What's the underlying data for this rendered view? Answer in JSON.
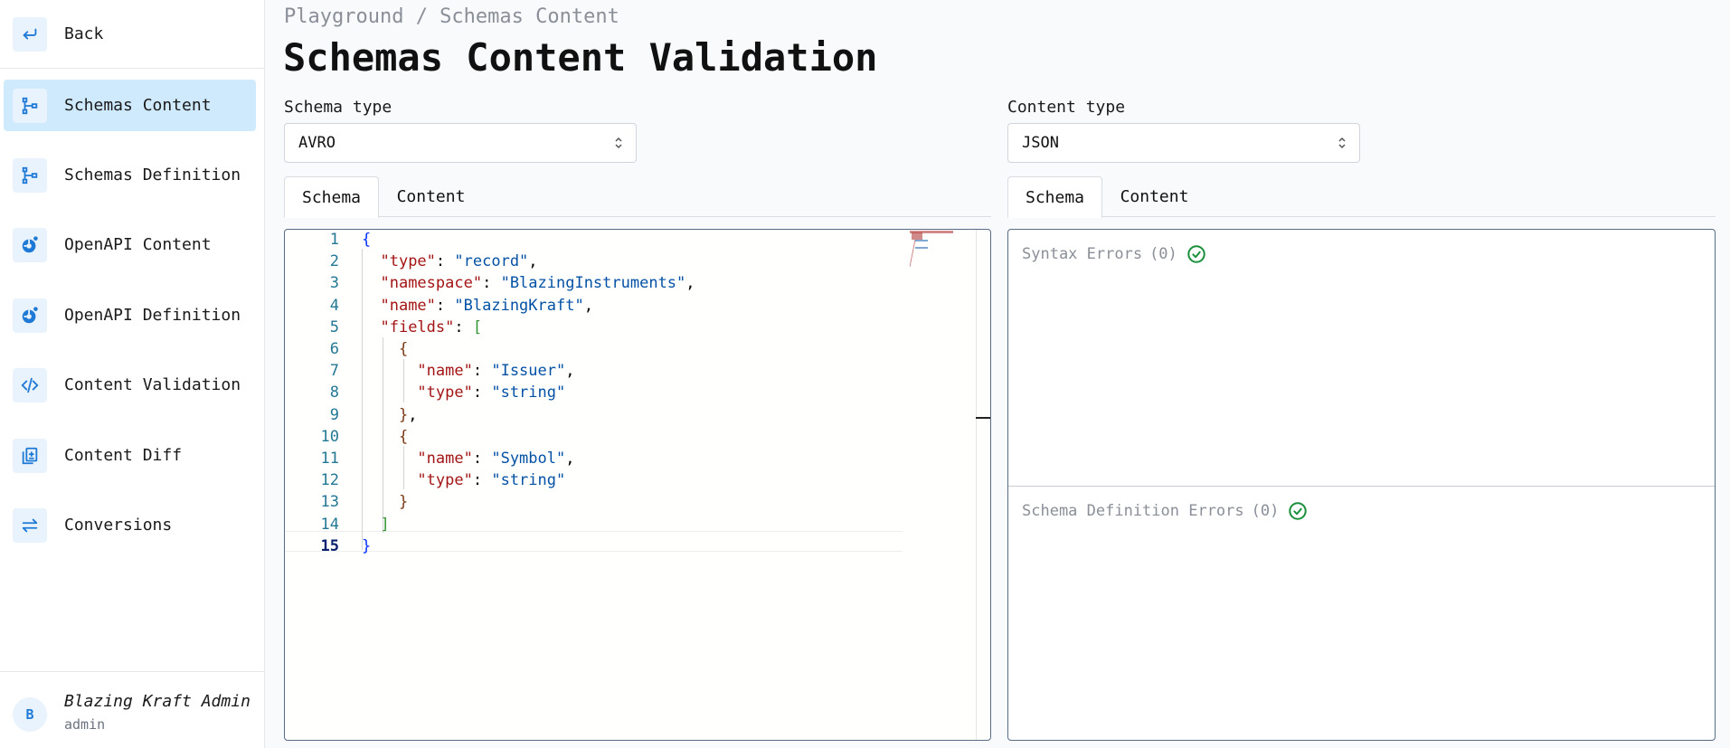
{
  "sidebar": {
    "back_label": "Back",
    "items": [
      {
        "label": "Schemas Content",
        "icon": "schema-tree-icon",
        "active": true
      },
      {
        "label": "Schemas Definition",
        "icon": "schema-tree-icon",
        "active": false
      },
      {
        "label": "OpenAPI Content",
        "icon": "openapi-icon",
        "active": false
      },
      {
        "label": "OpenAPI Definition",
        "icon": "openapi-icon",
        "active": false
      },
      {
        "label": "Content Validation",
        "icon": "code-icon",
        "active": false
      },
      {
        "label": "Content Diff",
        "icon": "diff-icon",
        "active": false
      },
      {
        "label": "Conversions",
        "icon": "arrows-exchange-icon",
        "active": false
      }
    ],
    "user": {
      "avatar": "B",
      "name": "Blazing Kraft Admin",
      "role": "admin"
    }
  },
  "header": {
    "breadcrumb": "Playground / Schemas Content",
    "title": "Schemas Content Validation"
  },
  "left": {
    "select_label": "Schema type",
    "select_value": "AVRO",
    "tabs": [
      "Schema",
      "Content"
    ],
    "active_tab": "Schema"
  },
  "right": {
    "select_label": "Content type",
    "select_value": "JSON",
    "tabs": [
      "Schema",
      "Content"
    ],
    "active_tab": "Schema"
  },
  "editor": {
    "current_line": 15,
    "lines": [
      "{",
      "  \"type\": \"record\",",
      "  \"namespace\": \"BlazingInstruments\",",
      "  \"name\": \"BlazingKraft\",",
      "  \"fields\": [",
      "    {",
      "      \"name\": \"Issuer\",",
      "      \"type\": \"string\"",
      "    },",
      "    {",
      "      \"name\": \"Symbol\",",
      "      \"type\": \"string\"",
      "    }",
      "  ]",
      "}"
    ]
  },
  "errors": {
    "syntax_label": "Syntax Errors",
    "syntax_count": "(0)",
    "definition_label": "Schema Definition Errors",
    "definition_count": "(0)"
  },
  "colors": {
    "accent": "#1f7ad6",
    "active_nav_bg": "#cfe9fd",
    "success": "#1a8f3c",
    "json_key": "#a31515",
    "json_string": "#0451a5"
  }
}
